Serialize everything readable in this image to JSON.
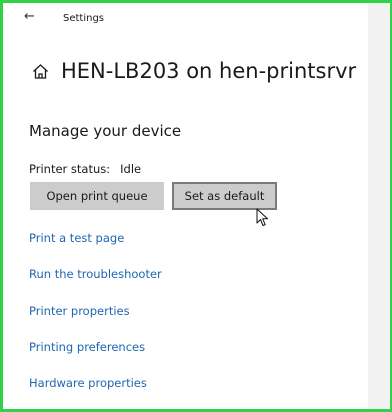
{
  "window": {
    "title": "Settings",
    "back_icon": "back-arrow-icon"
  },
  "header": {
    "icon": "home-icon",
    "title": "HEN-LB203 on hen-printsrvr"
  },
  "manage": {
    "section_title": "Manage your device",
    "status_label": "Printer status:",
    "status_value": "Idle",
    "buttons": {
      "open_queue": "Open print queue",
      "set_default": "Set as default"
    },
    "links": [
      "Print a test page",
      "Run the troubleshooter",
      "Printer properties",
      "Printing preferences",
      "Hardware properties"
    ]
  },
  "colors": {
    "link": "#1f66b3",
    "button_bg": "#cccccc",
    "frame": "#32d14a"
  }
}
